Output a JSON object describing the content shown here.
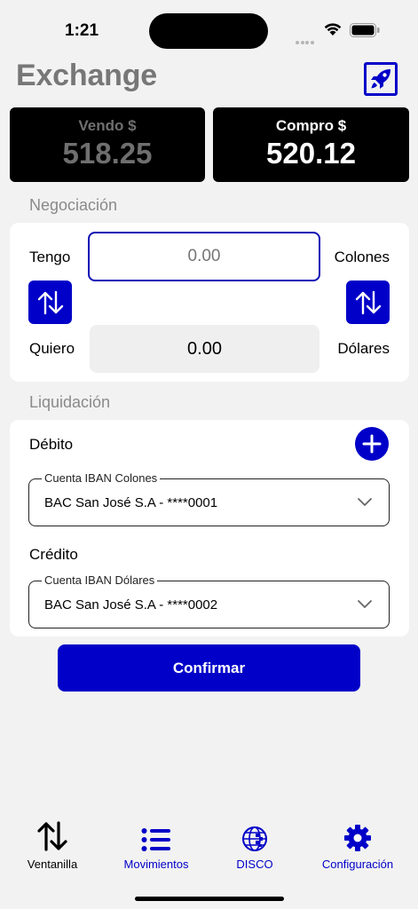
{
  "status": {
    "time": "1:21"
  },
  "header": {
    "title": "Exchange"
  },
  "rates": {
    "sell": {
      "label": "Vendo $",
      "value": "518.25"
    },
    "buy": {
      "label": "Compro $",
      "value": "520.12"
    }
  },
  "negotiation": {
    "section_title": "Negociación",
    "have_label": "Tengo",
    "have_currency": "Colones",
    "have_placeholder": "0.00",
    "want_label": "Quiero",
    "want_currency": "Dólares",
    "want_value": "0.00"
  },
  "settlement": {
    "section_title": "Liquidación",
    "debit_label": "Débito",
    "debit_account_legend": "Cuenta IBAN Colones",
    "debit_account_value": "BAC San José S.A - ****0001",
    "credit_label": "Crédito",
    "credit_account_legend": "Cuenta IBAN Dólares",
    "credit_account_value": "BAC San José S.A - ****0002"
  },
  "confirm_label": "Confirmar",
  "tabs": [
    {
      "label": "Ventanilla",
      "icon": "arrows-up-down-icon",
      "active": true
    },
    {
      "label": "Movimientos",
      "icon": "list-icon",
      "active": false
    },
    {
      "label": "DISCO",
      "icon": "globe-icon",
      "active": false
    },
    {
      "label": "Configuración",
      "icon": "gear-icon",
      "active": false
    }
  ],
  "colors": {
    "accent": "#0000c8",
    "background": "#f2f2f2"
  }
}
